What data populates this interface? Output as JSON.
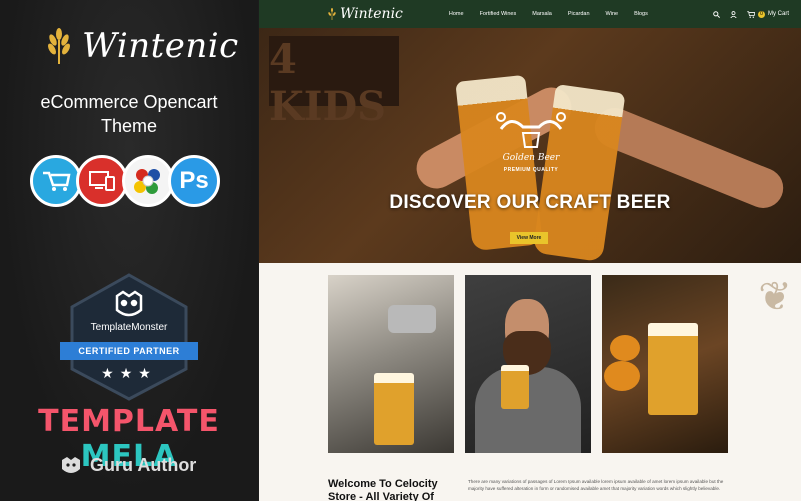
{
  "promo": {
    "brand": "Wintenic",
    "tagline_line1": "eCommerce Opencart",
    "tagline_line2": "Theme",
    "badges": [
      {
        "name": "opencart-cart-icon",
        "symbol": "🛒"
      },
      {
        "name": "responsive-devices-icon",
        "symbol": "▭"
      },
      {
        "name": "multilanguage-flags-icon",
        "symbol": "◍"
      },
      {
        "name": "photoshop-icon",
        "symbol": "Ps"
      }
    ],
    "certificate": {
      "brand": "TemplateMonster",
      "ribbon": "CERTIFIED PARTNER",
      "stars": "★★★"
    },
    "author_word1": "TEMPLATE ",
    "author_word2": "MELA",
    "guru": "Guru Author"
  },
  "site": {
    "logo": "Wintenic",
    "nav": [
      "Home",
      "Fortified Wines",
      "Marsala",
      "Picardan",
      "Wine",
      "Blogs"
    ],
    "cart_label": "My Cart",
    "cart_count": "0",
    "hero": {
      "sign_text": "4 KIDS",
      "emblem_title": "Golden Beer",
      "emblem_sub": "PREMIUM QUALITY",
      "title": "DISCOVER OUR CRAFT BEER",
      "button": "View More"
    },
    "welcome_title": "Welcome To Celocity Store - All Variety Of",
    "welcome_text": "There are many variations of passages of Lorem Ipsum available lorem ipsum available of amet lorem ipsum available but the majority have suffered alteration in form or randomised available amet that majority variation words which slightly believable."
  },
  "colors": {
    "nav_bg": "#1f3a24",
    "accent_yellow": "#e9c42b",
    "mela_pink": "#f4556b",
    "mela_teal": "#2cc6c0",
    "cert_blue": "#2d7ed6"
  }
}
